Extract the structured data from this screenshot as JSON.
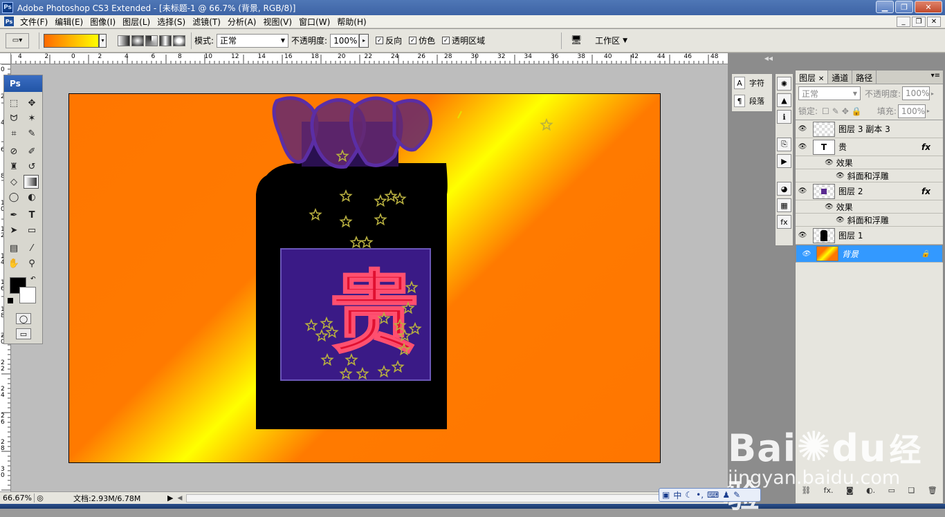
{
  "window": {
    "title": "Adobe Photoshop CS3 Extended - [未标题-1 @ 66.7% (背景, RGB/8)]",
    "app_icon": "Ps"
  },
  "menu": [
    "文件(F)",
    "编辑(E)",
    "图像(I)",
    "图层(L)",
    "选择(S)",
    "滤镜(T)",
    "分析(A)",
    "视图(V)",
    "窗口(W)",
    "帮助(H)"
  ],
  "options": {
    "mode_label": "模式:",
    "mode_value": "正常",
    "opacity_label": "不透明度:",
    "opacity_value": "100%",
    "reverse_label": "反向",
    "dither_label": "仿色",
    "transparency_label": "透明区域",
    "workspace_label": "工作区",
    "gradient_colors": [
      "#ff6a00",
      "#ffff00"
    ]
  },
  "ruler_top": [
    "4",
    "2",
    "0",
    "2",
    "4",
    "6",
    "8",
    "10",
    "12",
    "14",
    "16",
    "18",
    "20",
    "22",
    "24",
    "26",
    "28",
    "30",
    "32",
    "34",
    "36",
    "38",
    "40",
    "42",
    "44",
    "46",
    "48"
  ],
  "ruler_left": [
    "0",
    "2",
    "4",
    "6",
    "8",
    "10",
    "12",
    "14",
    "16",
    "18",
    "20",
    "22",
    "24",
    "26",
    "28",
    "30"
  ],
  "toolbox": {
    "header": "Ps"
  },
  "canvas": {
    "seal_char": "贵",
    "background_colors": [
      "#ff7600",
      "#ffff00"
    ],
    "bottle_color": "#000000",
    "panel_color": "#3a1a86",
    "star_color": "#b8b040"
  },
  "status": {
    "zoom": "66.67%",
    "doc_info": "文档:2.93M/6.78M"
  },
  "char_panel": {
    "character_label": "字符",
    "paragraph_label": "段落"
  },
  "layers_panel": {
    "tabs": [
      "图层",
      "通道",
      "路径"
    ],
    "blend_mode": "正常",
    "opacity_label": "不透明度:",
    "opacity_value": "100%",
    "lock_label": "锁定:",
    "fill_label": "填充:",
    "fill_value": "100%",
    "layers": [
      {
        "name": "图层 3 副本 3",
        "fx": ""
      },
      {
        "name": "贵",
        "fx": "fx",
        "thumb": "T"
      },
      {
        "name": "图层 2",
        "fx": "fx"
      },
      {
        "name": "图层 1",
        "fx": ""
      },
      {
        "name": "背景",
        "fx": ""
      }
    ],
    "effects_label": "效果",
    "bevel_label": "斜面和浮雕"
  },
  "watermark": {
    "brand": "Bai",
    "brand2": "du",
    "cn": "经验",
    "url": "jingyan.baidu.com"
  },
  "ime": {
    "lang": "中"
  }
}
